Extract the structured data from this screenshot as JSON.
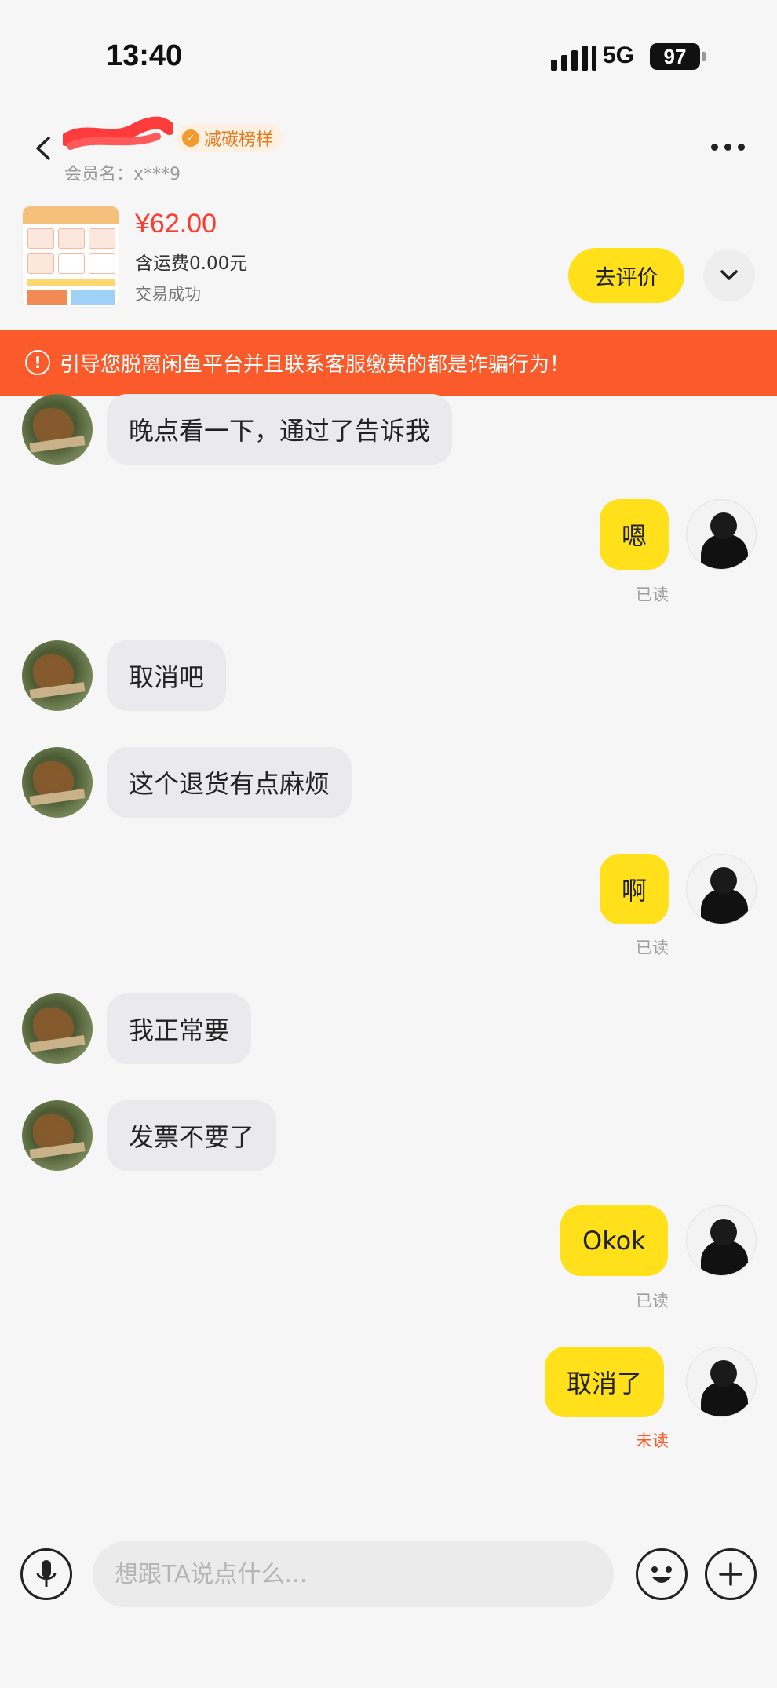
{
  "status_bar": {
    "time": "13:40",
    "network": "5G",
    "battery": "97"
  },
  "header": {
    "badge": "减碳榜样",
    "member_name": "会员名：x***9"
  },
  "product": {
    "price": "¥62.00",
    "shipping": "含运费0.00元",
    "status": "交易成功",
    "review_button": "去评价"
  },
  "warning": "引导您脱离闲鱼平台并且联系客服缴费的都是诈骗行为！",
  "messages": [
    {
      "side": "left",
      "text": "晚点看一下，通过了告诉我"
    },
    {
      "side": "right",
      "text": "嗯",
      "status": "已读"
    },
    {
      "side": "left",
      "text": "取消吧"
    },
    {
      "side": "left",
      "text": "这个退货有点麻烦"
    },
    {
      "side": "right",
      "text": "啊",
      "status": "已读"
    },
    {
      "side": "left",
      "text": "我正常要"
    },
    {
      "side": "left",
      "text": "发票不要了"
    },
    {
      "side": "right",
      "text": "Okok",
      "status": "已读"
    },
    {
      "side": "right",
      "text": "取消了",
      "status": "未读"
    }
  ],
  "input": {
    "placeholder": "想跟TA说点什么..."
  },
  "colors": {
    "accent_yellow": "#ffe01a",
    "warning_orange": "#fb5a2a",
    "price_red": "#ff3b30"
  }
}
